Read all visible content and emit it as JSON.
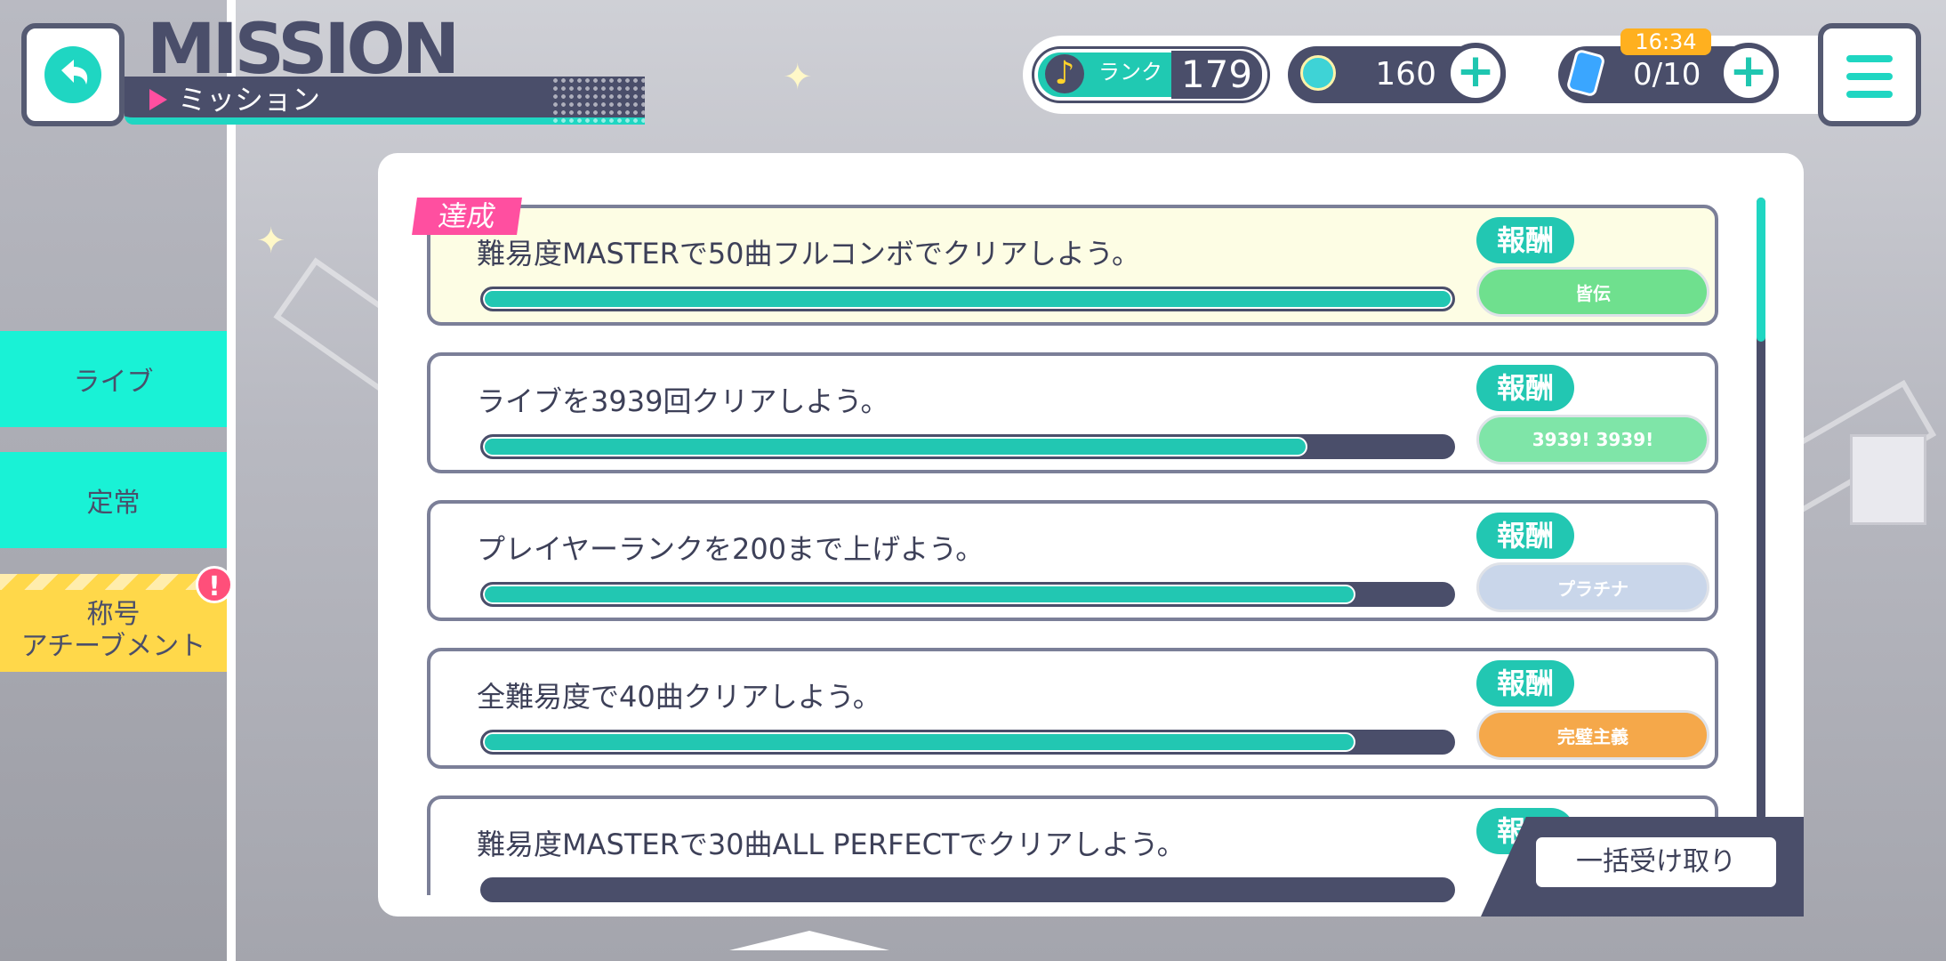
{
  "header": {
    "title_en": "MISSION",
    "title_jp": "ミッション"
  },
  "status": {
    "rank_label": "ランク",
    "rank_value": "179",
    "gems": "160",
    "energy": "0/10",
    "timer": "16:34"
  },
  "tabs": [
    {
      "label": "ライブ"
    },
    {
      "label": "定常"
    },
    {
      "label_line1": "称号",
      "label_line2": "アチーブメント",
      "badge": "!"
    }
  ],
  "done_tag": "達成",
  "reward_label": "報酬",
  "missions": [
    {
      "text": "難易度MASTERで50曲フルコンボでクリアしよう。",
      "progress": 1.0,
      "reward_text": "皆伝",
      "reward_color": "#6fe08e",
      "done": true
    },
    {
      "text": "ライブを3939回クリアしよう。",
      "progress": 0.85,
      "reward_text": "3939!  3939!",
      "reward_color": "#7fe5a8",
      "done": false
    },
    {
      "text": "プレイヤーランクを200まで上げよう。",
      "progress": 0.9,
      "reward_text": "プラチナ",
      "reward_color": "#c9d6ea",
      "done": false
    },
    {
      "text": "全難易度で40曲クリアしよう。",
      "progress": 0.9,
      "reward_text": "完璧主義",
      "reward_color": "#f5a84a",
      "done": false
    },
    {
      "text": "難易度MASTERで30曲ALL PERFECTでクリアしよう。",
      "progress": 0.0,
      "reward_text": "",
      "reward_color": "#f0b9d8",
      "done": false
    }
  ],
  "bulk_button": "一括受け取り",
  "colors": {
    "accent": "#22c7b2",
    "navy": "#4a4e6a",
    "pink": "#ff4fa0",
    "yellow": "#ffd84a"
  }
}
